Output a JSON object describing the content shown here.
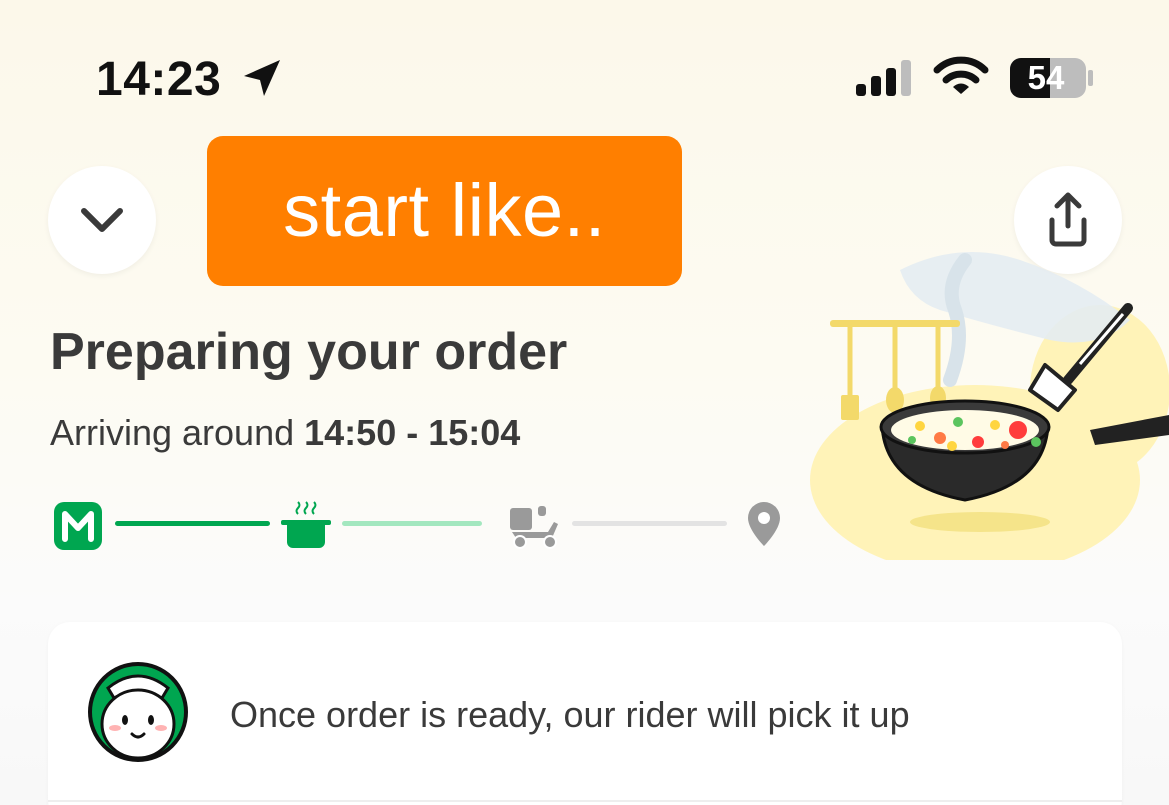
{
  "status_bar": {
    "time": "14:23",
    "battery_level": "54",
    "icons": [
      "location-arrow-icon",
      "cellular-signal-icon",
      "wifi-icon",
      "battery-icon"
    ]
  },
  "header": {
    "collapse_icon": "chevron-down-icon",
    "share_icon": "share-upload-icon",
    "overlay_text": "start like..",
    "overlay_color": "#ff7f00"
  },
  "order": {
    "status_title": "Preparing your order",
    "eta_prefix": "Arriving around",
    "eta_window": "14:50 - 15:04"
  },
  "progress": {
    "steps": [
      {
        "icon": "restaurant-m-icon",
        "state": "done"
      },
      {
        "icon": "cooking-pot-icon",
        "state": "active"
      },
      {
        "icon": "delivery-scooter-icon",
        "state": "pending"
      },
      {
        "icon": "location-pin-icon",
        "state": "pending"
      }
    ],
    "colors": {
      "done": "#00a650",
      "active": "#a3e7bf",
      "pending": "#e3e3e3"
    }
  },
  "illustration": {
    "icon": "cooking-wok-illustration"
  },
  "info_card": {
    "avatar_icon": "rider-helmet-avatar-icon",
    "message": "Once order is ready, our rider will pick it up"
  },
  "colors": {
    "brand_green": "#00a650",
    "text": "#3a3a3a"
  }
}
